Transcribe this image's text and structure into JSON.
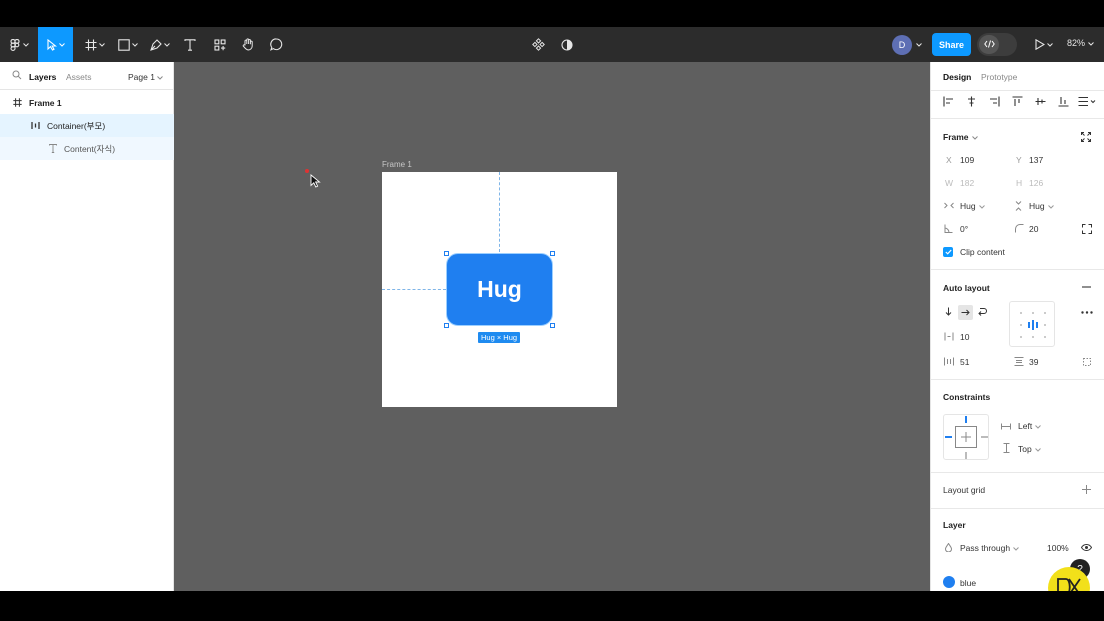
{
  "toolbar": {
    "avatar_initial": "D",
    "share_label": "Share",
    "zoom_label": "82%",
    "accent_color": "#0d99ff"
  },
  "left_panel": {
    "tab_layers": "Layers",
    "tab_assets": "Assets",
    "page_label": "Page 1",
    "layers": [
      {
        "label": "Frame 1",
        "icon": "frame-icon"
      },
      {
        "label": "Container(부모)",
        "icon": "auto-layout-icon"
      },
      {
        "label": "Content(자식)",
        "icon": "text-icon"
      }
    ]
  },
  "canvas": {
    "frame_label": "Frame 1",
    "hug_text": "Hug",
    "size_badge": "Hug × Hug",
    "background_color": "#5f5f5f",
    "element_color": "#1f7ff0"
  },
  "right_panel": {
    "tab_design": "Design",
    "tab_prototype": "Prototype",
    "frame_section": {
      "title": "Frame",
      "x_label": "X",
      "x_value": "109",
      "y_label": "Y",
      "y_value": "137",
      "w_label": "W",
      "w_value": "182",
      "h_label": "H",
      "h_value": "126",
      "width_mode": "Hug",
      "height_mode": "Hug",
      "rotation": "0°",
      "corner_radius": "20",
      "clip_content_label": "Clip content",
      "clip_content_checked": true
    },
    "auto_layout": {
      "title": "Auto layout",
      "gap": "10",
      "padding_horizontal": "51",
      "padding_vertical": "39"
    },
    "constraints": {
      "title": "Constraints",
      "horizontal": "Left",
      "vertical": "Top"
    },
    "layout_grid": {
      "title": "Layout grid"
    },
    "layer": {
      "title": "Layer",
      "blend_mode": "Pass through",
      "opacity": "100%"
    },
    "fill": {
      "color_name": "blue",
      "color": "#1f7ff0"
    }
  },
  "help": {
    "label": "?"
  }
}
